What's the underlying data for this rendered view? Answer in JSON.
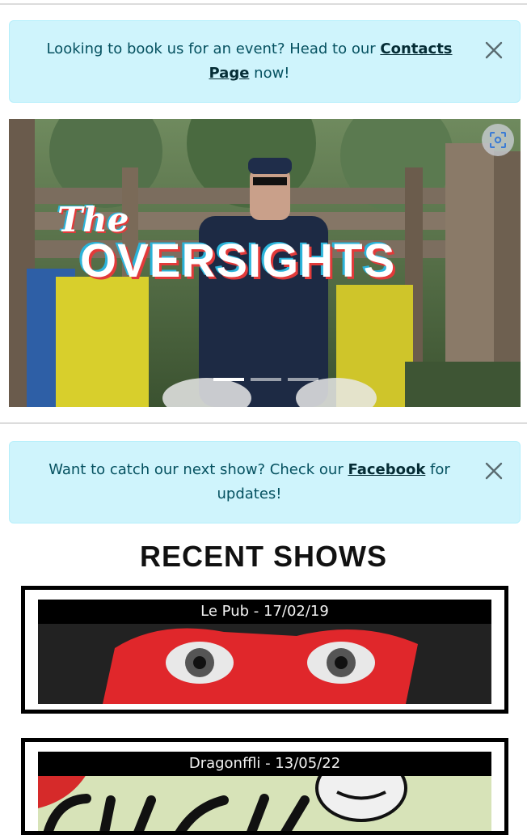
{
  "alerts": [
    {
      "text_before": "Looking to book us for an event? Head to our ",
      "link": "Contacts Page",
      "text_after": " now!"
    },
    {
      "text_before": "Want to catch our next show? Check our ",
      "link": "Facebook",
      "text_after": " for updates!"
    }
  ],
  "carousel": {
    "title_script": "The",
    "title_main": "OVERSIGHTS",
    "slide_count": 3,
    "active_slide": 1
  },
  "recent_shows": {
    "heading": "RECENT SHOWS",
    "items": [
      {
        "caption": "Le Pub - 17/02/19"
      },
      {
        "caption": "Dragonffli - 13/05/22"
      }
    ]
  },
  "colors": {
    "alert_bg": "#cff4fc",
    "alert_text": "#055160"
  },
  "icons": {
    "close": "close-icon",
    "zoom": "zoom-focus-icon"
  }
}
